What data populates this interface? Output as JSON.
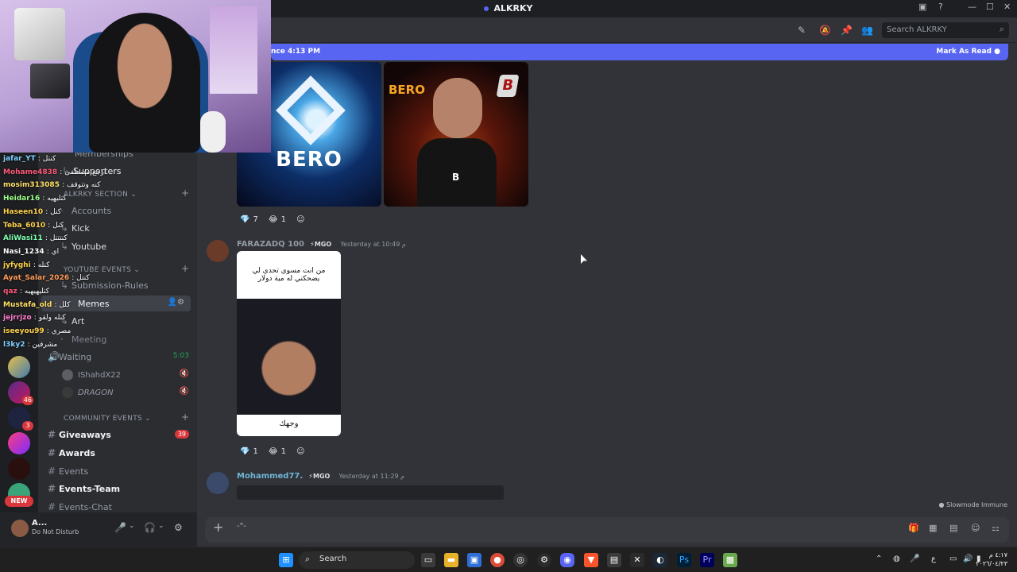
{
  "window": {
    "title": "ALKRKY"
  },
  "header": {
    "search_placeholder": "Search ALKRKY",
    "icons": [
      "threads-icon",
      "mute-bell-icon",
      "pin-icon",
      "members-icon",
      "search-icon"
    ]
  },
  "new_messages_bar": {
    "text": "nce 4:13 PM",
    "mark_read": "Mark As Read"
  },
  "stream_chat": [
    {
      "user": "jafar_YT",
      "msg": ": كنتل",
      "color": "#7fd1ff"
    },
    {
      "user": "Mohame4838",
      "msg": ": ارجع مصطفى",
      "color": "#ff5a7a"
    },
    {
      "user": "mosim313085",
      "msg": ": كنه وتتوقف",
      "color": "#ffe066"
    },
    {
      "user": "Heidar16",
      "msg": ": كتليهيه",
      "color": "#9dff8a"
    },
    {
      "user": "Haseen10",
      "msg": ": كنل",
      "color": "#ffd24d"
    },
    {
      "user": "Teba_6010",
      "msg": ": كنل",
      "color": "#ffd24d"
    },
    {
      "user": "AliWasi11",
      "msg": ": كنتتتل",
      "color": "#7fffb0"
    },
    {
      "user": "Nasi_1234",
      "msg": ": اي",
      "color": "#ffffff"
    },
    {
      "user": "jyfyghi",
      "msg": ": كنله",
      "color": "#ffd24d"
    },
    {
      "user": "Ayat_Salar_2026",
      "msg": ": كنتل",
      "color": "#ff9a5a"
    },
    {
      "user": "qaz",
      "msg": ": كتليهيهيه",
      "color": "#ff5a7a"
    },
    {
      "user": "Mustafa_old",
      "msg": ": كلل",
      "color": "#ffe066"
    },
    {
      "user": "jejrrjzo",
      "msg": ": كنله ولقو",
      "color": "#ff7fd1"
    },
    {
      "user": "iseeyou99",
      "msg": ": مصري",
      "color": "#ffd24d"
    },
    {
      "user": "l3ky2",
      "msg": ": مشرفين",
      "color": "#7fd1ff"
    }
  ],
  "channels": {
    "memberships": "Memberships",
    "supporters": "Supporters",
    "cat_alkrky": "ALKRKY SECTION",
    "accounts": "Accounts",
    "kick": "Kick",
    "youtube": "Youtube",
    "cat_youtube": "YOUTUBE EVENTS",
    "submission_rules": "Submission-Rules",
    "memes": "Memes",
    "art": "Art",
    "meeting": "Meeting",
    "waiting": "Waiting",
    "waiting_time": "5:03",
    "voice_users": [
      "IShahdX22",
      "DRAGON"
    ],
    "cat_community": "COMMUNITY EVENTS",
    "giveaways": "Giveaways",
    "giveaways_badge": "39",
    "awards": "Awards",
    "events": "Events",
    "events_team": "Events-Team",
    "events_chat": "Events-Chat"
  },
  "servers": {
    "badges": [
      "46",
      "3"
    ],
    "new_label": "NEW"
  },
  "messages": [
    {
      "images": [
        "BERO",
        "BERO"
      ],
      "reactions": [
        {
          "emoji": "💎",
          "count": "7"
        },
        {
          "emoji": "😂",
          "count": "1"
        }
      ]
    },
    {
      "author": "FARAZADQ 100",
      "tag": "⚡MGO",
      "time": "Yesterday at 10:49 م",
      "meme_top": "من انت مسوي تحدي لي يضحكني له مية دولار",
      "meme_bottom": "وجهك",
      "reactions": [
        {
          "emoji": "💎",
          "count": "1"
        },
        {
          "emoji": "😂",
          "count": "1"
        }
      ]
    },
    {
      "author": "Mohammed77.",
      "tag": "⚡MGO",
      "time": "Yesterday at 11:29 م"
    }
  ],
  "slowmode": "Slowmode Immune",
  "user_panel": {
    "name": "A...",
    "status": "Do Not Disturb"
  },
  "composer": {
    "text": "-\"-"
  },
  "taskbar": {
    "search": "Search",
    "clock_time": "٤:١٧ م",
    "clock_date": "٢٠٢٦/٠٤/٢٣",
    "lang": "ع"
  },
  "colors": {
    "accent": "#5865f2",
    "badge": "#da373c",
    "voice_green": "#23a559"
  }
}
